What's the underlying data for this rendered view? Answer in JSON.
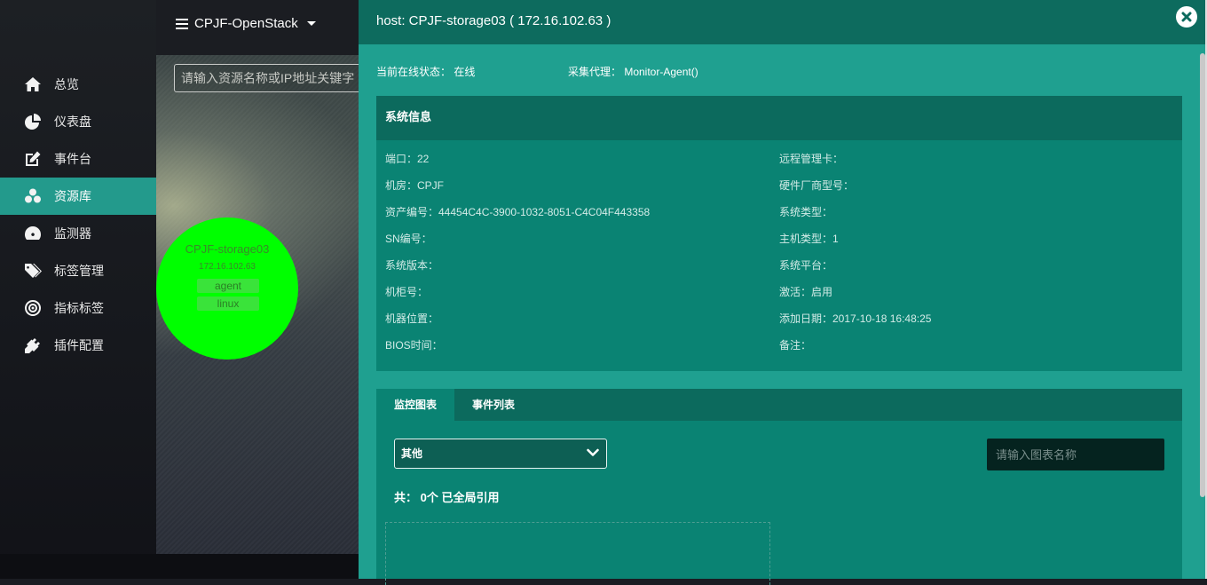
{
  "topbar": {
    "cluster_label": "CPJF-OpenStack"
  },
  "sidebar": {
    "items": [
      {
        "label": "总览",
        "icon": "home-icon"
      },
      {
        "label": "仪表盘",
        "icon": "pie-chart-icon"
      },
      {
        "label": "事件台",
        "icon": "edit-icon"
      },
      {
        "label": "资源库",
        "icon": "cubes-icon",
        "active": true
      },
      {
        "label": "监测器",
        "icon": "dashboard-gauge-icon"
      },
      {
        "label": "标签管理",
        "icon": "tags-icon"
      },
      {
        "label": "指标标签",
        "icon": "target-icon"
      },
      {
        "label": "插件配置",
        "icon": "plug-icon"
      }
    ]
  },
  "stage": {
    "search_placeholder": "请输入资源名称或IP地址关键字",
    "node": {
      "name": "CPJF-storage03",
      "ip": "172.16.102.63",
      "tags": [
        "agent",
        "linux"
      ],
      "color": "#00ff00"
    }
  },
  "panel": {
    "title": "host: CPJF-storage03 ( 172.16.102.63 )",
    "status_text": "当前在线状态： 在线",
    "agent_text": "采集代理： Monitor-Agent()",
    "sysinfo": {
      "heading": "系统信息",
      "left": [
        "端口：22",
        "机房：CPJF",
        "资产编号：44454C4C-3900-1032-8051-C4C04F443358",
        "SN编号：",
        "系统版本：",
        "机柜号：",
        "机器位置：",
        "BIOS时间："
      ],
      "right": [
        "远程管理卡：",
        "硬件厂商型号：",
        "系统类型：",
        "主机类型：1",
        "系统平台：",
        "激活：启用",
        "添加日期：2017-10-18 16:48:25",
        "备注："
      ]
    },
    "tabs": [
      {
        "label": "监控图表",
        "active": true
      },
      {
        "label": "事件列表",
        "active": false
      }
    ],
    "group_select": {
      "value": "其他"
    },
    "chart_search_placeholder": "请输入图表名称",
    "count_line": "共： 0个 已全局引用"
  },
  "colors": {
    "accent": "#239a8c",
    "panel_bg": "#1fa090",
    "panel_header": "#0d6b5e",
    "card_bg": "#0a8373"
  }
}
